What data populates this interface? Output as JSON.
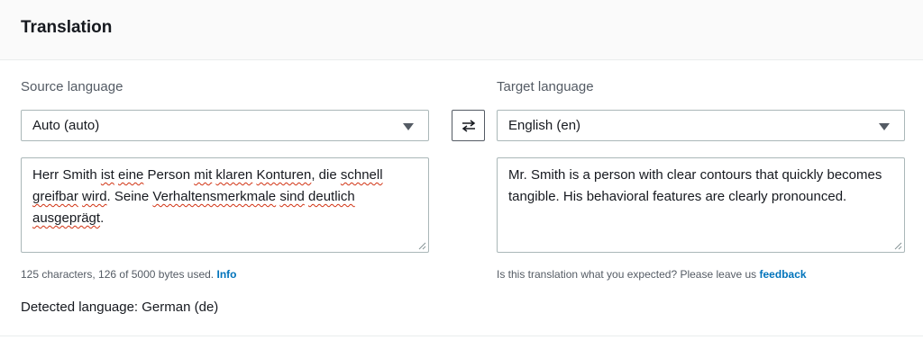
{
  "panel": {
    "title": "Translation"
  },
  "source": {
    "label": "Source language",
    "selected": "Auto (auto)",
    "text_segments": [
      {
        "t": "Herr Smith ",
        "spell": false
      },
      {
        "t": "ist",
        "spell": true
      },
      {
        "t": " ",
        "spell": false
      },
      {
        "t": "eine",
        "spell": true
      },
      {
        "t": " Person ",
        "spell": false
      },
      {
        "t": "mit",
        "spell": true
      },
      {
        "t": " ",
        "spell": false
      },
      {
        "t": "klaren",
        "spell": true
      },
      {
        "t": " ",
        "spell": false
      },
      {
        "t": "Konturen",
        "spell": true
      },
      {
        "t": ", die ",
        "spell": false
      },
      {
        "t": "schnell",
        "spell": true
      },
      {
        "t": " ",
        "spell": false
      },
      {
        "t": "greifbar",
        "spell": true
      },
      {
        "t": " ",
        "spell": false
      },
      {
        "t": "wird",
        "spell": true
      },
      {
        "t": ". Seine ",
        "spell": false
      },
      {
        "t": "Verhaltensmerkmale",
        "spell": true
      },
      {
        "t": " ",
        "spell": false
      },
      {
        "t": "sind",
        "spell": true
      },
      {
        "t": " ",
        "spell": false
      },
      {
        "t": "deutlich",
        "spell": true
      },
      {
        "t": " ",
        "spell": false
      },
      {
        "t": "ausgeprägt",
        "spell": true
      },
      {
        "t": ".",
        "spell": false
      }
    ],
    "helper_text": "125 characters, 126 of 5000 bytes used.",
    "helper_link": "Info"
  },
  "target": {
    "label": "Target language",
    "selected": "English (en)",
    "text": "Mr. Smith is a person with clear contours that quickly becomes tangible. His behavioral features are clearly pronounced.",
    "helper_text": "Is this translation what you expected? Please leave us",
    "helper_link": "feedback"
  },
  "swap": {
    "icon": "swap-arrows-icon"
  },
  "detected_language": "Detected language: German (de)",
  "colors": {
    "link": "#0073bb",
    "text": "#16191f",
    "muted": "#545b64",
    "border": "#aab7b8",
    "spell_error": "#d13212"
  }
}
